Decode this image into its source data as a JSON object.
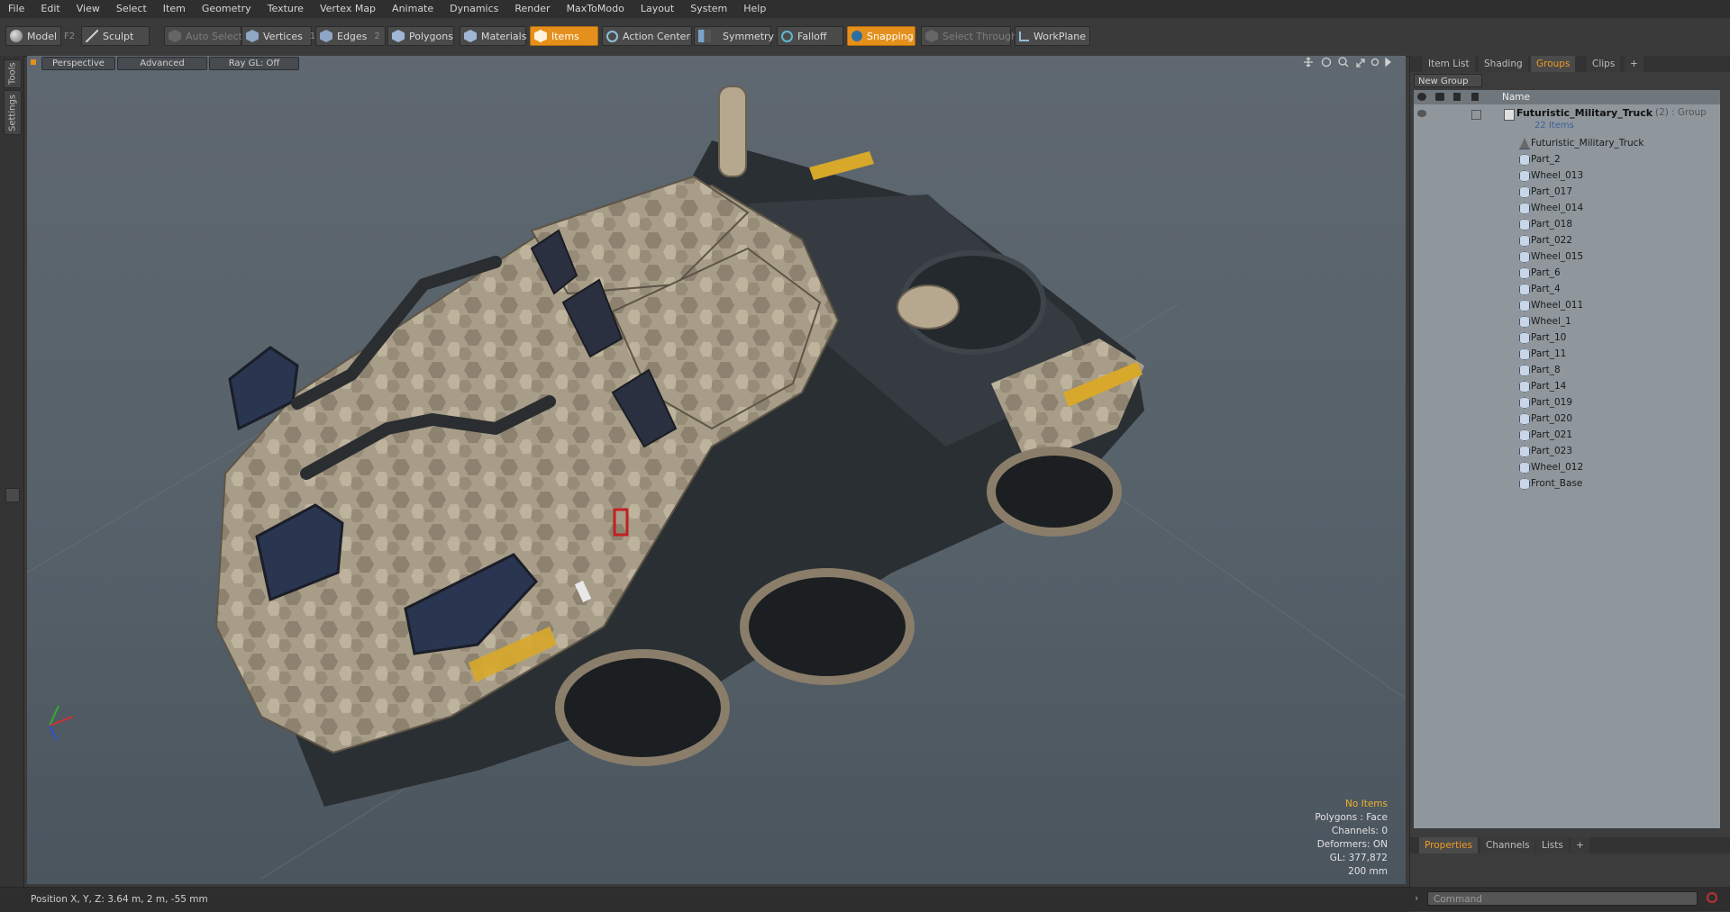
{
  "menu": [
    "File",
    "Edit",
    "View",
    "Select",
    "Item",
    "Geometry",
    "Texture",
    "Vertex Map",
    "Animate",
    "Dynamics",
    "Render",
    "MaxToModo",
    "Layout",
    "System",
    "Help"
  ],
  "toolbar": {
    "model": "Model",
    "model_key": "F2",
    "sculpt": "Sculpt",
    "auto_select": "Auto Select",
    "vertices": "Vertices",
    "vertices_key": "1",
    "edges": "Edges",
    "edges_key": "2",
    "polygons": "Polygons",
    "materials": "Materials",
    "items": "Items",
    "action_center": "Action Center",
    "symmetry": "Symmetry",
    "falloff": "Falloff",
    "snapping": "Snapping",
    "select_through": "Select Through",
    "workplane": "WorkPlane"
  },
  "left_strip": {
    "tools": "Tools",
    "settings": "Settings"
  },
  "viewport": {
    "view": "Perspective",
    "shading": "Advanced",
    "raygl": "Ray GL: Off",
    "info": {
      "items": "No Items",
      "polygons": "Polygons : Face",
      "channels": "Channels: 0",
      "deformers": "Deformers: ON",
      "gl": "GL: 377,872",
      "scale": "200 mm"
    }
  },
  "right_panel": {
    "tabs": [
      "Item List",
      "Shading",
      "Groups",
      "Clips"
    ],
    "active_tab": "Groups",
    "new_group": "New Group",
    "col_name": "Name",
    "group": {
      "name": "Futuristic_Military_Truck",
      "count": "(2)",
      "type": ": Group",
      "items": "22 Items"
    },
    "children": [
      "Futuristic_Military_Truck",
      "Part_2",
      "Wheel_013",
      "Part_017",
      "Wheel_014",
      "Part_018",
      "Part_022",
      "Wheel_015",
      "Part_6",
      "Part_4",
      "Wheel_011",
      "Wheel_1",
      "Part_10",
      "Part_11",
      "Part_8",
      "Part_14",
      "Part_019",
      "Part_020",
      "Part_021",
      "Part_023",
      "Wheel_012",
      "Front_Base"
    ],
    "bottom_tabs": [
      "Properties",
      "Channels",
      "Lists"
    ],
    "bottom_active": "Properties"
  },
  "status": {
    "position": "Position X, Y, Z:   3.64 m, 2 m, -55 mm"
  },
  "command": {
    "placeholder": "Command"
  },
  "colors": {
    "accent": "#e5901c",
    "list_bg": "#8f979d",
    "viewport": "#58636c"
  }
}
